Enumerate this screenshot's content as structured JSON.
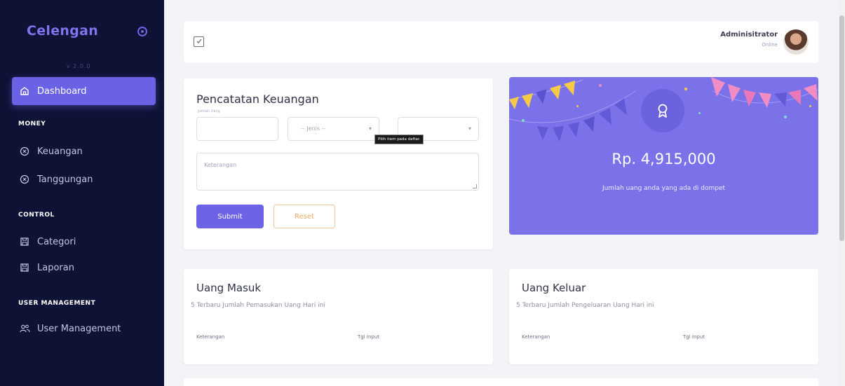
{
  "sidebar": {
    "brand": "Celengan",
    "version": "v 2.0.0",
    "active_item": {
      "label": "Dashboard",
      "icon": "home-icon"
    },
    "sections": [
      {
        "title": "MONEY",
        "items": [
          {
            "label": "Keuangan",
            "icon": "circle-x-icon"
          },
          {
            "label": "Tanggungan",
            "icon": "circle-x-icon"
          }
        ]
      },
      {
        "title": "CONTROL",
        "items": [
          {
            "label": "Categori",
            "icon": "save-icon"
          },
          {
            "label": "Laporan",
            "icon": "save-icon"
          }
        ]
      },
      {
        "title": "USER MANAGEMENT",
        "items": [
          {
            "label": "User Management",
            "icon": "users-icon"
          }
        ]
      }
    ]
  },
  "topbar": {
    "icon": "edit-square-icon",
    "user_name": "Adminisitrator",
    "user_status": "Online"
  },
  "form": {
    "title": "Pencatatan Keuangan",
    "amount_label": "Jumlah Uang",
    "jenis_placeholder": "-- Jenis --",
    "kategori_placeholder": "",
    "tooltip": "Pilih item pada daftar.",
    "keterangan_placeholder": "Keterangan",
    "submit_label": "Submit",
    "reset_label": "Reset"
  },
  "balance": {
    "icon": "award-icon",
    "amount": "Rp. 4,915,000",
    "caption": "Jumlah uang anda yang ada di dompet",
    "accent_color": "#7b72ea"
  },
  "uang_masuk": {
    "title": "Uang Masuk",
    "subtitle": "5 Terbaru Jumlah Pemasukan Uang Hari ini",
    "columns": [
      "Keterangan",
      "Tgl Input"
    ]
  },
  "uang_keluar": {
    "title": "Uang Keluar",
    "subtitle": "5 Terbaru Jumlah Pengeluaran Uang Hari ini",
    "columns": [
      "Keterangan",
      "Tgl Input"
    ]
  }
}
